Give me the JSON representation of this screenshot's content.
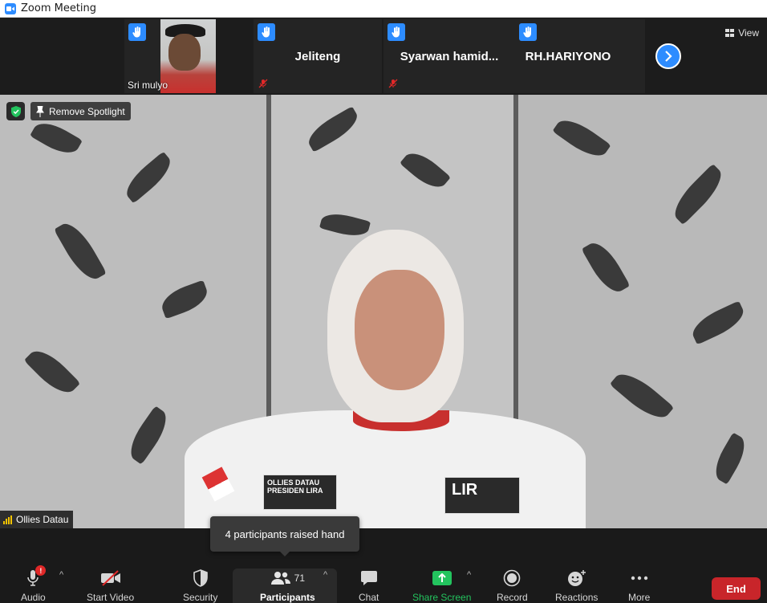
{
  "window": {
    "title": "Zoom Meeting"
  },
  "colors": {
    "accent": "#2d8cff",
    "share_green": "#23c45e",
    "end_red": "#c8252a",
    "audio_bars": "#f5c400"
  },
  "gallery": {
    "tiles": [
      {
        "name": "Sri mulyo",
        "has_video": true,
        "hand_raised": true,
        "muted": false
      },
      {
        "name": "Jeliteng",
        "has_video": false,
        "hand_raised": true,
        "muted": true
      },
      {
        "name": "Syarwan  hamid...",
        "has_video": false,
        "hand_raised": true,
        "muted": true
      },
      {
        "name": "RH.HARIYONO",
        "has_video": false,
        "hand_raised": true,
        "muted": false
      }
    ],
    "next_icon": "chevron-right-icon",
    "view_label": "View"
  },
  "spotlight": {
    "remove_label": "Remove Spotlight",
    "speaker_name": "Ollies Datau",
    "badge_left_text": "OLLIES DATAU PRESIDEN LIRA",
    "badge_right_text": "LIR"
  },
  "tooltip": {
    "text": "4 participants raised hand"
  },
  "toolbar": {
    "audio": "Audio",
    "audio_alert": "!",
    "start_video": "Start Video",
    "security": "Security",
    "participants": "Participants",
    "participants_count": "71",
    "chat": "Chat",
    "share_screen": "Share Screen",
    "record": "Record",
    "reactions": "Reactions",
    "more": "More",
    "end": "End"
  }
}
